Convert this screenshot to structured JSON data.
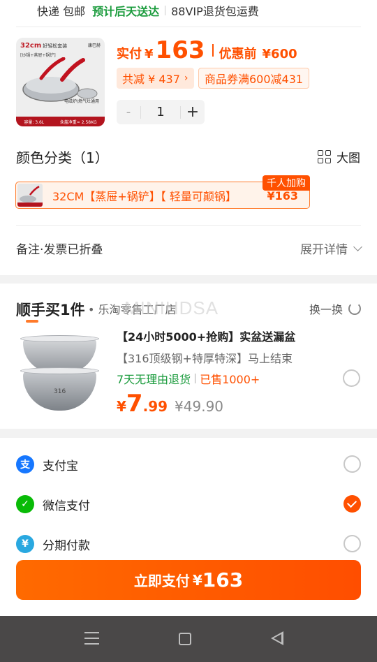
{
  "shipping": {
    "method": "快递 包邮",
    "eta": "预计后天送达",
    "vip": "88VIP退货包运费"
  },
  "product": {
    "image": {
      "size_tag": "32cm",
      "size_tag_note": "好轻松套装",
      "bundle": "[炒锅+蒸屉+锅铲]",
      "brand": "康巴赫",
      "note": "电磁炉/燃气灶通用",
      "capacity": "容量: 3.6L",
      "weight": "含盖净重≈ 2.58KG"
    },
    "price_label": "实付",
    "currency": "¥",
    "price": "163",
    "original_label": "优惠前",
    "original_price": "¥600",
    "savings_text": "共减 ¥ 437",
    "coupon_text": "商品券满600减431",
    "quantity": "1",
    "minus": "-",
    "plus": "+"
  },
  "variant_section": {
    "title": "颜色分类（1）",
    "big_view_label": "大图",
    "selected_label": "32CM【蒸屉+锅铲】【 轻量可颠锅】",
    "selected_price": "¥163",
    "badge": "千人加购"
  },
  "note": {
    "label": "备注·发票已折叠",
    "expand_label": "展开详情"
  },
  "addon": {
    "title": "顺手买1件",
    "shop": "• 乐淘零售工厂店",
    "swap_label": "换一换",
    "watermark": "MINIHDSA",
    "item": {
      "name": "【24小时5000+抢购】实盆送漏盆",
      "desc": "【316顶级钢+特厚特深】马上结束",
      "return_policy": "7天无理由退货",
      "sold": "已售1000+",
      "currency": "¥",
      "price_int": "7",
      "price_dec": ".99",
      "original": "¥49.90",
      "bowl_mark": "316"
    }
  },
  "payment": {
    "options": [
      {
        "name": "支付宝",
        "icon": "alipay-icon",
        "icon_glyph": "支",
        "color": "#1677ff",
        "selected": false
      },
      {
        "name": "微信支付",
        "icon": "wechat-icon",
        "icon_glyph": "✓",
        "color": "#09bb07",
        "selected": true
      },
      {
        "name": "分期付款",
        "icon": "installment-icon",
        "icon_glyph": "¥",
        "color": "#29a8e0",
        "selected": false
      }
    ],
    "pay_button": {
      "label": "立即支付",
      "currency": "¥",
      "amount": "163"
    }
  },
  "colors": {
    "accent": "#ff5000",
    "green": "#1a9b3c"
  }
}
